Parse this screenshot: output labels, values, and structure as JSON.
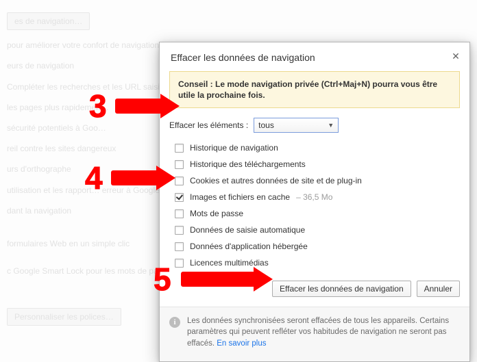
{
  "bg": {
    "l0": "es de navigation…",
    "l1": "pour améliorer votre confort de navigation. Vous avez la",
    "l2": "eurs de navigation",
    "l3": "Compléter les recherches et les URL saisies dans la barre d…",
    "l4": "les pages plus rapidemen…",
    "l5": "sécurité potentiels à Goo…",
    "l6": "reil contre les sites dangereux",
    "l7": "urs d'orthographe",
    "l8": "utilisation et les rapport… erreur à Google",
    "l9": "dant la navigation",
    "l10": "formulaires Web en un simple clic",
    "l11": "c Google Smart Lock pour les mots de passe",
    "btn": "Personnaliser les polices…"
  },
  "dialog": {
    "title": "Effacer les données de navigation",
    "tip_pre": "Conseil : ",
    "tip_body": "Le mode navigation privée (Ctrl+Maj+N) pourra vous être utile la prochaine fois.",
    "dropdown_label": "Effacer les éléments :",
    "dropdown_value": "tous",
    "items": [
      {
        "label": "Historique de navigation",
        "checked": false
      },
      {
        "label": "Historique des téléchargements",
        "checked": false
      },
      {
        "label": "Cookies et autres données de site et de plug-in",
        "checked": false
      },
      {
        "label": "Images et fichiers en cache",
        "sub": " – 36,5 Mo",
        "checked": true
      },
      {
        "label": "Mots de passe",
        "checked": false
      },
      {
        "label": "Données de saisie automatique",
        "checked": false
      },
      {
        "label": "Données d'application hébergée",
        "checked": false
      },
      {
        "label": "Licences multimédias",
        "checked": false
      }
    ],
    "clear_btn": "Effacer les données de navigation",
    "cancel_btn": "Annuler",
    "footer_text": "Les données synchronisées seront effacées de tous les appareils. Certains paramètres qui peuvent refléter vos habitudes de navigation ne seront pas effacés. ",
    "footer_link": "En savoir plus"
  },
  "marks": {
    "n3": "3",
    "n4": "4",
    "n5": "5"
  }
}
